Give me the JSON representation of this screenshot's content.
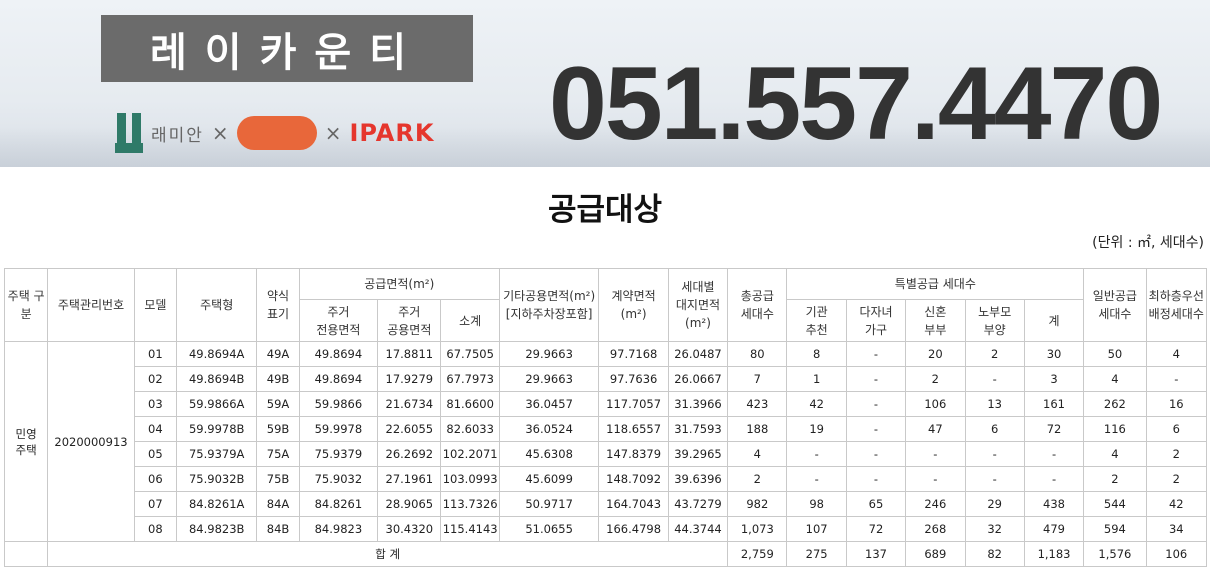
{
  "banner": {
    "brand_text": "레이카운티",
    "partner1": "래미안",
    "times": "×",
    "partner3": "IPARK",
    "phone": "051.557.4470"
  },
  "title": "공급대상",
  "unit": "(단위 : ㎡, 세대수)",
  "headers": {
    "housing_type": "주택\n구분",
    "mgmt_no": "주택관리번호",
    "model": "모델",
    "house_type": "주택형",
    "abbr": "약식\n표기",
    "supply_area": "공급면적(m²)",
    "residential_exclusive": "주거\n전용면적",
    "residential_common": "주거\n공용면적",
    "subtotal": "소계",
    "other_common": "기타공용면적(m²)\n[지하주차장포함]",
    "contract_area": "계약면적\n(m²)",
    "land_area": "세대별\n대지면적\n(m²)",
    "total_supply": "총공급\n세대수",
    "special_supply": "특별공급 세대수",
    "institution": "기관\n추천",
    "multi_child": "다자녀\n가구",
    "newlywed": "신혼\n부부",
    "elderly_parent": "노부모\n부양",
    "special_total": "계",
    "general_supply": "일반공급\n세대수",
    "top_floor": "최하층우선\n배정세대수"
  },
  "group": {
    "type": "민영\n주택",
    "mgmt_no": "2020000913"
  },
  "rows": [
    {
      "model": "01",
      "type": "49.8694A",
      "abbr": "49A",
      "excl": "49.8694",
      "common": "17.8811",
      "sub": "67.7505",
      "other": "29.9663",
      "contract": "97.7168",
      "land": "26.0487",
      "total": "80",
      "inst": "8",
      "multi": "-",
      "newly": "20",
      "elder": "2",
      "stotal": "30",
      "general": "50",
      "top": "4"
    },
    {
      "model": "02",
      "type": "49.8694B",
      "abbr": "49B",
      "excl": "49.8694",
      "common": "17.9279",
      "sub": "67.7973",
      "other": "29.9663",
      "contract": "97.7636",
      "land": "26.0667",
      "total": "7",
      "inst": "1",
      "multi": "-",
      "newly": "2",
      "elder": "-",
      "stotal": "3",
      "general": "4",
      "top": "-"
    },
    {
      "model": "03",
      "type": "59.9866A",
      "abbr": "59A",
      "excl": "59.9866",
      "common": "21.6734",
      "sub": "81.6600",
      "other": "36.0457",
      "contract": "117.7057",
      "land": "31.3966",
      "total": "423",
      "inst": "42",
      "multi": "-",
      "newly": "106",
      "elder": "13",
      "stotal": "161",
      "general": "262",
      "top": "16"
    },
    {
      "model": "04",
      "type": "59.9978B",
      "abbr": "59B",
      "excl": "59.9978",
      "common": "22.6055",
      "sub": "82.6033",
      "other": "36.0524",
      "contract": "118.6557",
      "land": "31.7593",
      "total": "188",
      "inst": "19",
      "multi": "-",
      "newly": "47",
      "elder": "6",
      "stotal": "72",
      "general": "116",
      "top": "6"
    },
    {
      "model": "05",
      "type": "75.9379A",
      "abbr": "75A",
      "excl": "75.9379",
      "common": "26.2692",
      "sub": "102.2071",
      "other": "45.6308",
      "contract": "147.8379",
      "land": "39.2965",
      "total": "4",
      "inst": "-",
      "multi": "-",
      "newly": "-",
      "elder": "-",
      "stotal": "-",
      "general": "4",
      "top": "2"
    },
    {
      "model": "06",
      "type": "75.9032B",
      "abbr": "75B",
      "excl": "75.9032",
      "common": "27.1961",
      "sub": "103.0993",
      "other": "45.6099",
      "contract": "148.7092",
      "land": "39.6396",
      "total": "2",
      "inst": "-",
      "multi": "-",
      "newly": "-",
      "elder": "-",
      "stotal": "-",
      "general": "2",
      "top": "2"
    },
    {
      "model": "07",
      "type": "84.8261A",
      "abbr": "84A",
      "excl": "84.8261",
      "common": "28.9065",
      "sub": "113.7326",
      "other": "50.9717",
      "contract": "164.7043",
      "land": "43.7279",
      "total": "982",
      "inst": "98",
      "multi": "65",
      "newly": "246",
      "elder": "29",
      "stotal": "438",
      "general": "544",
      "top": "42"
    },
    {
      "model": "08",
      "type": "84.9823B",
      "abbr": "84B",
      "excl": "84.9823",
      "common": "30.4320",
      "sub": "115.4143",
      "other": "51.0655",
      "contract": "166.4798",
      "land": "44.3744",
      "total": "1,073",
      "inst": "107",
      "multi": "72",
      "newly": "268",
      "elder": "32",
      "stotal": "479",
      "general": "594",
      "top": "34"
    }
  ],
  "totals": {
    "label": "합 계",
    "total": "2,759",
    "inst": "275",
    "multi": "137",
    "newly": "689",
    "elder": "82",
    "stotal": "1,183",
    "general": "1,576",
    "top": "106"
  },
  "colors": {
    "ipark": "#e5362d",
    "blob": "#e8673a",
    "raemian": "#2f7a68",
    "brand_box": "#6b6b6b"
  }
}
